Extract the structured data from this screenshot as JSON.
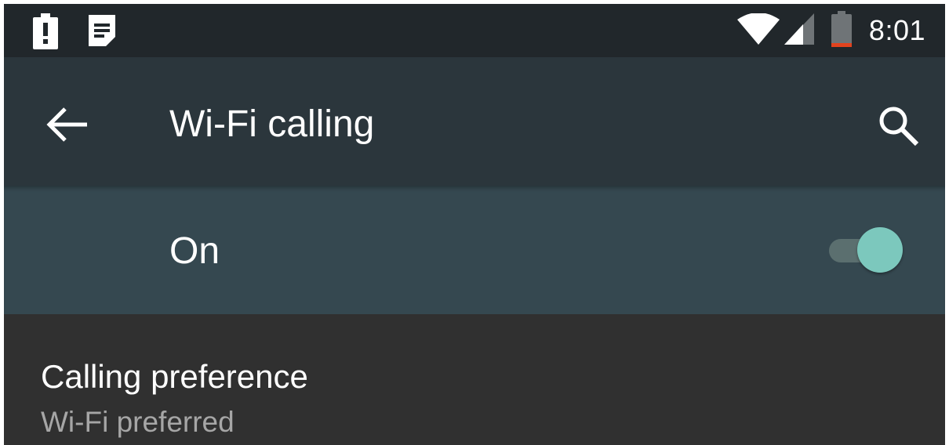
{
  "status_bar": {
    "time": "8:01",
    "icons": [
      "alert-battery-icon",
      "notes-icon",
      "wifi-icon",
      "cell-signal-icon",
      "battery-icon"
    ]
  },
  "toolbar": {
    "back_icon": "arrow-back-icon",
    "title": "Wi-Fi calling",
    "search_icon": "search-icon"
  },
  "master_switch": {
    "label": "On",
    "checked": true
  },
  "preferences": [
    {
      "title": "Calling preference",
      "summary": "Wi-Fi preferred"
    }
  ],
  "colors": {
    "status_bar": "#21272b",
    "toolbar": "#2b363c",
    "switch_bar": "#354850",
    "background": "#303030",
    "accent": "#7cc8bd",
    "battery_low": "#e2431e"
  }
}
